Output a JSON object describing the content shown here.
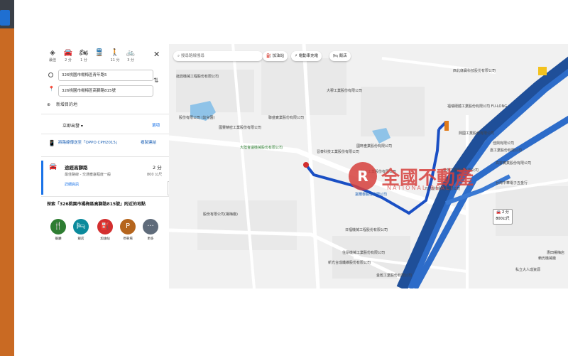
{
  "colors": {
    "accent": "#1a73e8",
    "route": "#2563c9",
    "water": "#8fc3e8",
    "watermark": "#d6403d"
  },
  "modes": [
    {
      "icon": "diamond-directions-icon",
      "label": "最佳"
    },
    {
      "icon": "car-icon",
      "label": "2 分"
    },
    {
      "icon": "motorcycle-icon",
      "label": "1 分"
    },
    {
      "icon": "transit-icon",
      "label": ""
    },
    {
      "icon": "walk-icon",
      "label": "11 分"
    },
    {
      "icon": "bicycle-icon",
      "label": "3 分"
    }
  ],
  "origin": "326桃園市楊梅區青年路5",
  "destination": "326桃園市楊梅區高獅路815號",
  "add_stop": "新增目的地",
  "depart_label": "立即出發 ▾",
  "options_label": "選項",
  "send": {
    "text": "將路線傳送至「OPPO CPH2015」",
    "copy": "複製連結"
  },
  "route": {
    "name": "途經高獅路",
    "time": "2 分",
    "sub": "最佳路線 - 交通壅塞程度一般",
    "distance": "800 公尺",
    "details": "詳細資訊"
  },
  "nearby_title": "探索「326桃園市楊梅區高獅路815號」附近的地點",
  "categories": [
    {
      "glyph": "🍴",
      "label": "餐廳",
      "color": "#2e7d32"
    },
    {
      "glyph": "🛏",
      "label": "飯店",
      "color": "#0b8a9c"
    },
    {
      "glyph": "⛽",
      "label": "加油站",
      "color": "#d32f2f"
    },
    {
      "glyph": "P",
      "label": "停車場",
      "color": "#b5651d"
    },
    {
      "glyph": "···",
      "label": "更多",
      "color": "#5f6b7a"
    }
  ],
  "map_search_placeholder": "搜尋路線搜尋",
  "chips": [
    "⛽ 加油站",
    "⚡ 電動車充電",
    "🛏 飯店"
  ],
  "map_labels": [
    "鈺鼎機械工程股份有限公司",
    "大穆工業股份有限公司",
    "西北綠寶科技股份有限公司",
    "福瑞硬體工業股份有限公司 FU-LONG",
    "興國工業股份有限公司",
    "佳興有限公司",
    "股份有限公司 (幼兒園)",
    "聯盛實業股份有限公司",
    "國豐精密工業股份有限公司",
    "大陸會議機械股份有限公司",
    "晉泰科技工業股份有限公司",
    "國軒產業股份有限公司",
    "嘉工業股份有限公司",
    "高雲實業股份有限公司",
    "台灣中華電子五金行",
    "富爾泰股份有限公司",
    "日福機械工程股份有限公司",
    "住昂機械工業股份有限公司",
    "新光合成纖維股份有限公司",
    "金乾工業股份有限公司",
    "賴氏機械廠",
    "私立大人成資源",
    "惠田楊梅店",
    "元巴創作股份有限公司",
    "股份有限公司(楊梅廠)",
    "統一工業股份有限公司",
    "泰芳工業股份有限公司"
  ],
  "route_time_box": {
    "time": "2 分",
    "dist": "800公尺"
  },
  "watermark": {
    "logo": "R",
    "text": "全國不動產",
    "sub": "NATIONAL REALTY"
  }
}
